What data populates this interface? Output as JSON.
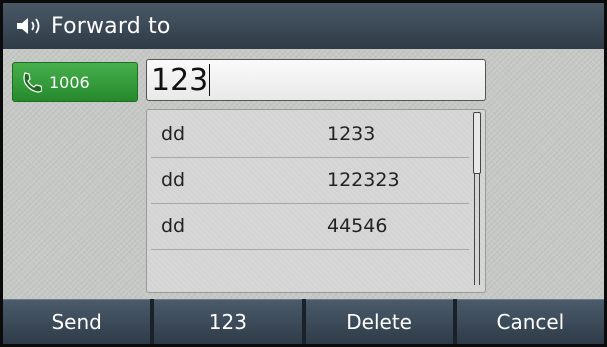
{
  "header": {
    "title": "Forward to",
    "icon": "speaker-icon"
  },
  "line_key": {
    "label": "1006",
    "icon": "phone-icon",
    "color": "#2e9634"
  },
  "input": {
    "value": "123"
  },
  "suggestions": [
    {
      "name": "dd",
      "number": "1233"
    },
    {
      "name": "dd",
      "number": "122323"
    },
    {
      "name": "dd",
      "number": "44546"
    }
  ],
  "softkeys": [
    "Send",
    "123",
    "Delete",
    "Cancel"
  ]
}
